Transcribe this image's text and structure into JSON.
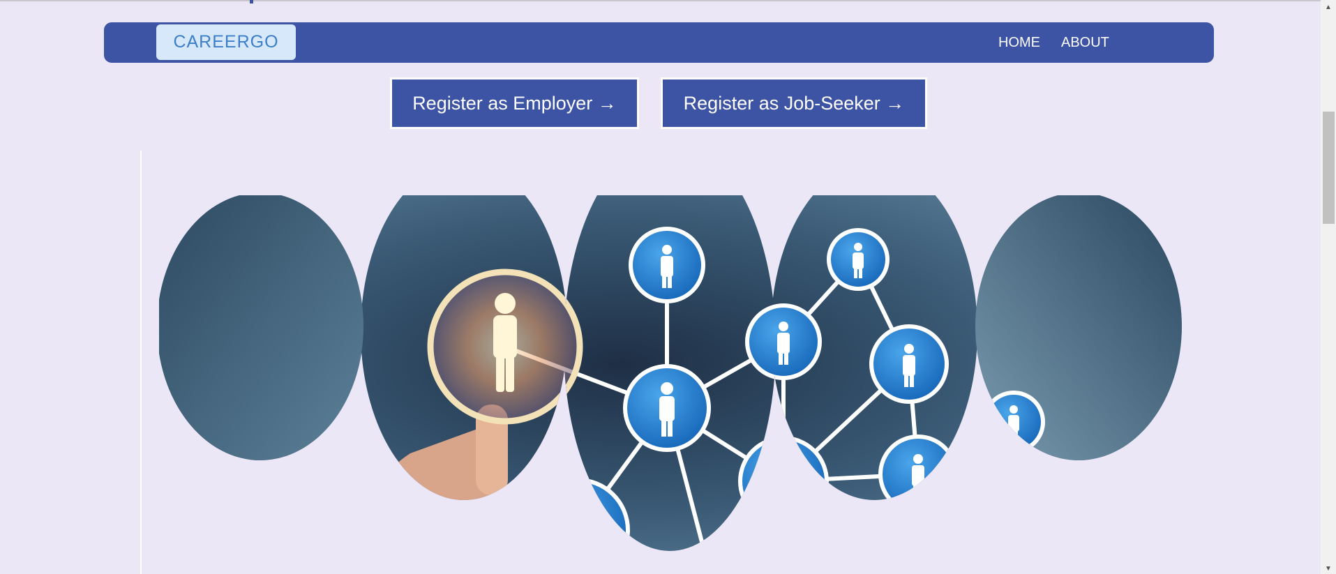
{
  "logo": {
    "text": "CAREERGO"
  },
  "nav": {
    "home": "HOME",
    "about": "ABOUT"
  },
  "register": {
    "employer_label": "Register as Employer →",
    "seeker_label": "Register as Job-Seeker →"
  },
  "colors": {
    "background": "#ece7f6",
    "primary": "#3d53a3",
    "logo_bg": "#d7e8fb",
    "logo_text": "#3c7fc8",
    "node": "#1e78c8",
    "glow": "#f5e6b8"
  },
  "hero": {
    "image_icon": "people-network-image"
  },
  "scrollbar": {
    "up_icon": "scroll-up-arrow-icon",
    "down_icon": "scroll-down-arrow-icon"
  }
}
